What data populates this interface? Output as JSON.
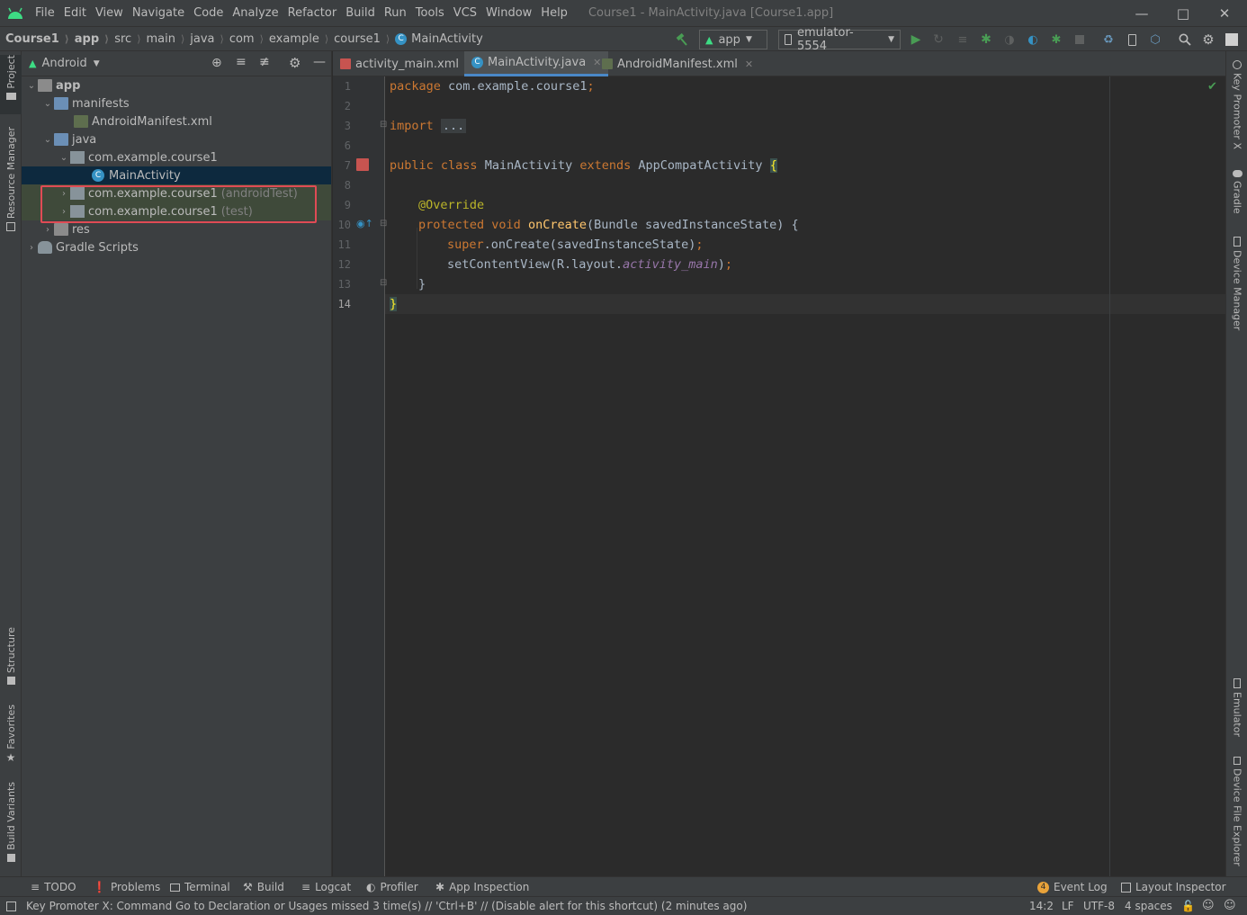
{
  "colors": {
    "accent": "#4a88c7",
    "highlight_box": "#e04b55",
    "run_green": "#499c54",
    "editor_bg": "#2b2b2b",
    "panel_bg": "#3c3f41"
  },
  "menubar": {
    "items": [
      "File",
      "Edit",
      "View",
      "Navigate",
      "Code",
      "Analyze",
      "Refactor",
      "Build",
      "Run",
      "Tools",
      "VCS",
      "Window",
      "Help"
    ],
    "window_title": "Course1 - MainActivity.java [Course1.app]"
  },
  "navbar": {
    "breadcrumbs": [
      "Course1",
      "app",
      "src",
      "main",
      "java",
      "com",
      "example",
      "course1",
      "MainActivity"
    ],
    "run_config": "app",
    "device": "emulator-5554"
  },
  "project": {
    "view_mode": "Android",
    "tree": [
      {
        "label": "app",
        "extra": ""
      },
      {
        "label": "manifests",
        "extra": ""
      },
      {
        "label": "AndroidManifest.xml",
        "extra": ""
      },
      {
        "label": "java",
        "extra": ""
      },
      {
        "label": "com.example.course1",
        "extra": ""
      },
      {
        "label": "MainActivity",
        "extra": ""
      },
      {
        "label": "com.example.course1",
        "extra": "(androidTest)"
      },
      {
        "label": "com.example.course1",
        "extra": "(test)"
      },
      {
        "label": "res",
        "extra": ""
      },
      {
        "label": "Gradle Scripts",
        "extra": ""
      }
    ]
  },
  "left_tabs": [
    "Project",
    "Resource Manager",
    "Structure",
    "Favorites",
    "Build Variants"
  ],
  "right_tabs": [
    "Key Promoter X",
    "Gradle",
    "Device Manager",
    "Emulator",
    "Device File Explorer"
  ],
  "editor": {
    "tabs": [
      {
        "label": "activity_main.xml"
      },
      {
        "label": "MainActivity.java"
      },
      {
        "label": "AndroidManifest.xml"
      }
    ],
    "line_numbers": [
      "1",
      "2",
      "3",
      "6",
      "7",
      "8",
      "9",
      "10",
      "11",
      "12",
      "13",
      "14"
    ],
    "code": {
      "l1_kw": "package",
      "l1_rest": " com.example.course1",
      "l1_semi": ";",
      "l3_kw": "import",
      "l3_dots": "...",
      "l7_kw1": "public",
      "l7_kw2": "class",
      "l7_name": " MainActivity ",
      "l7_kw3": "extends",
      "l7_super": " AppCompatActivity ",
      "l7_brace": "{",
      "l9_ann": "@Override",
      "l10_kw1": "protected",
      "l10_kw2": "void",
      "l10_fn": "onCreate",
      "l10_rest": "(Bundle savedInstanceState) {",
      "l11_kw": "super",
      "l11_rest": ".onCreate(savedInstanceState)",
      "l11_semi": ";",
      "l12_rest": "setContentView(R.layout.",
      "l12_it": "activity_main",
      "l12_end": ")",
      "l12_semi": ";",
      "l13": "}",
      "l14": "}"
    }
  },
  "bottom_tools": [
    "TODO",
    "Problems",
    "Terminal",
    "Build",
    "Logcat",
    "Profiler",
    "App Inspection"
  ],
  "bottom_right_tools": {
    "event_log": "Event Log",
    "event_count": "4",
    "layout_inspector": "Layout Inspector"
  },
  "status": {
    "message": "Key Promoter X: Command Go to Declaration or Usages missed 3 time(s) // 'Ctrl+B' // (Disable alert for this shortcut) (2 minutes ago)",
    "position": "14:2",
    "line_sep": "LF",
    "encoding": "UTF-8",
    "indent": "4 spaces"
  }
}
